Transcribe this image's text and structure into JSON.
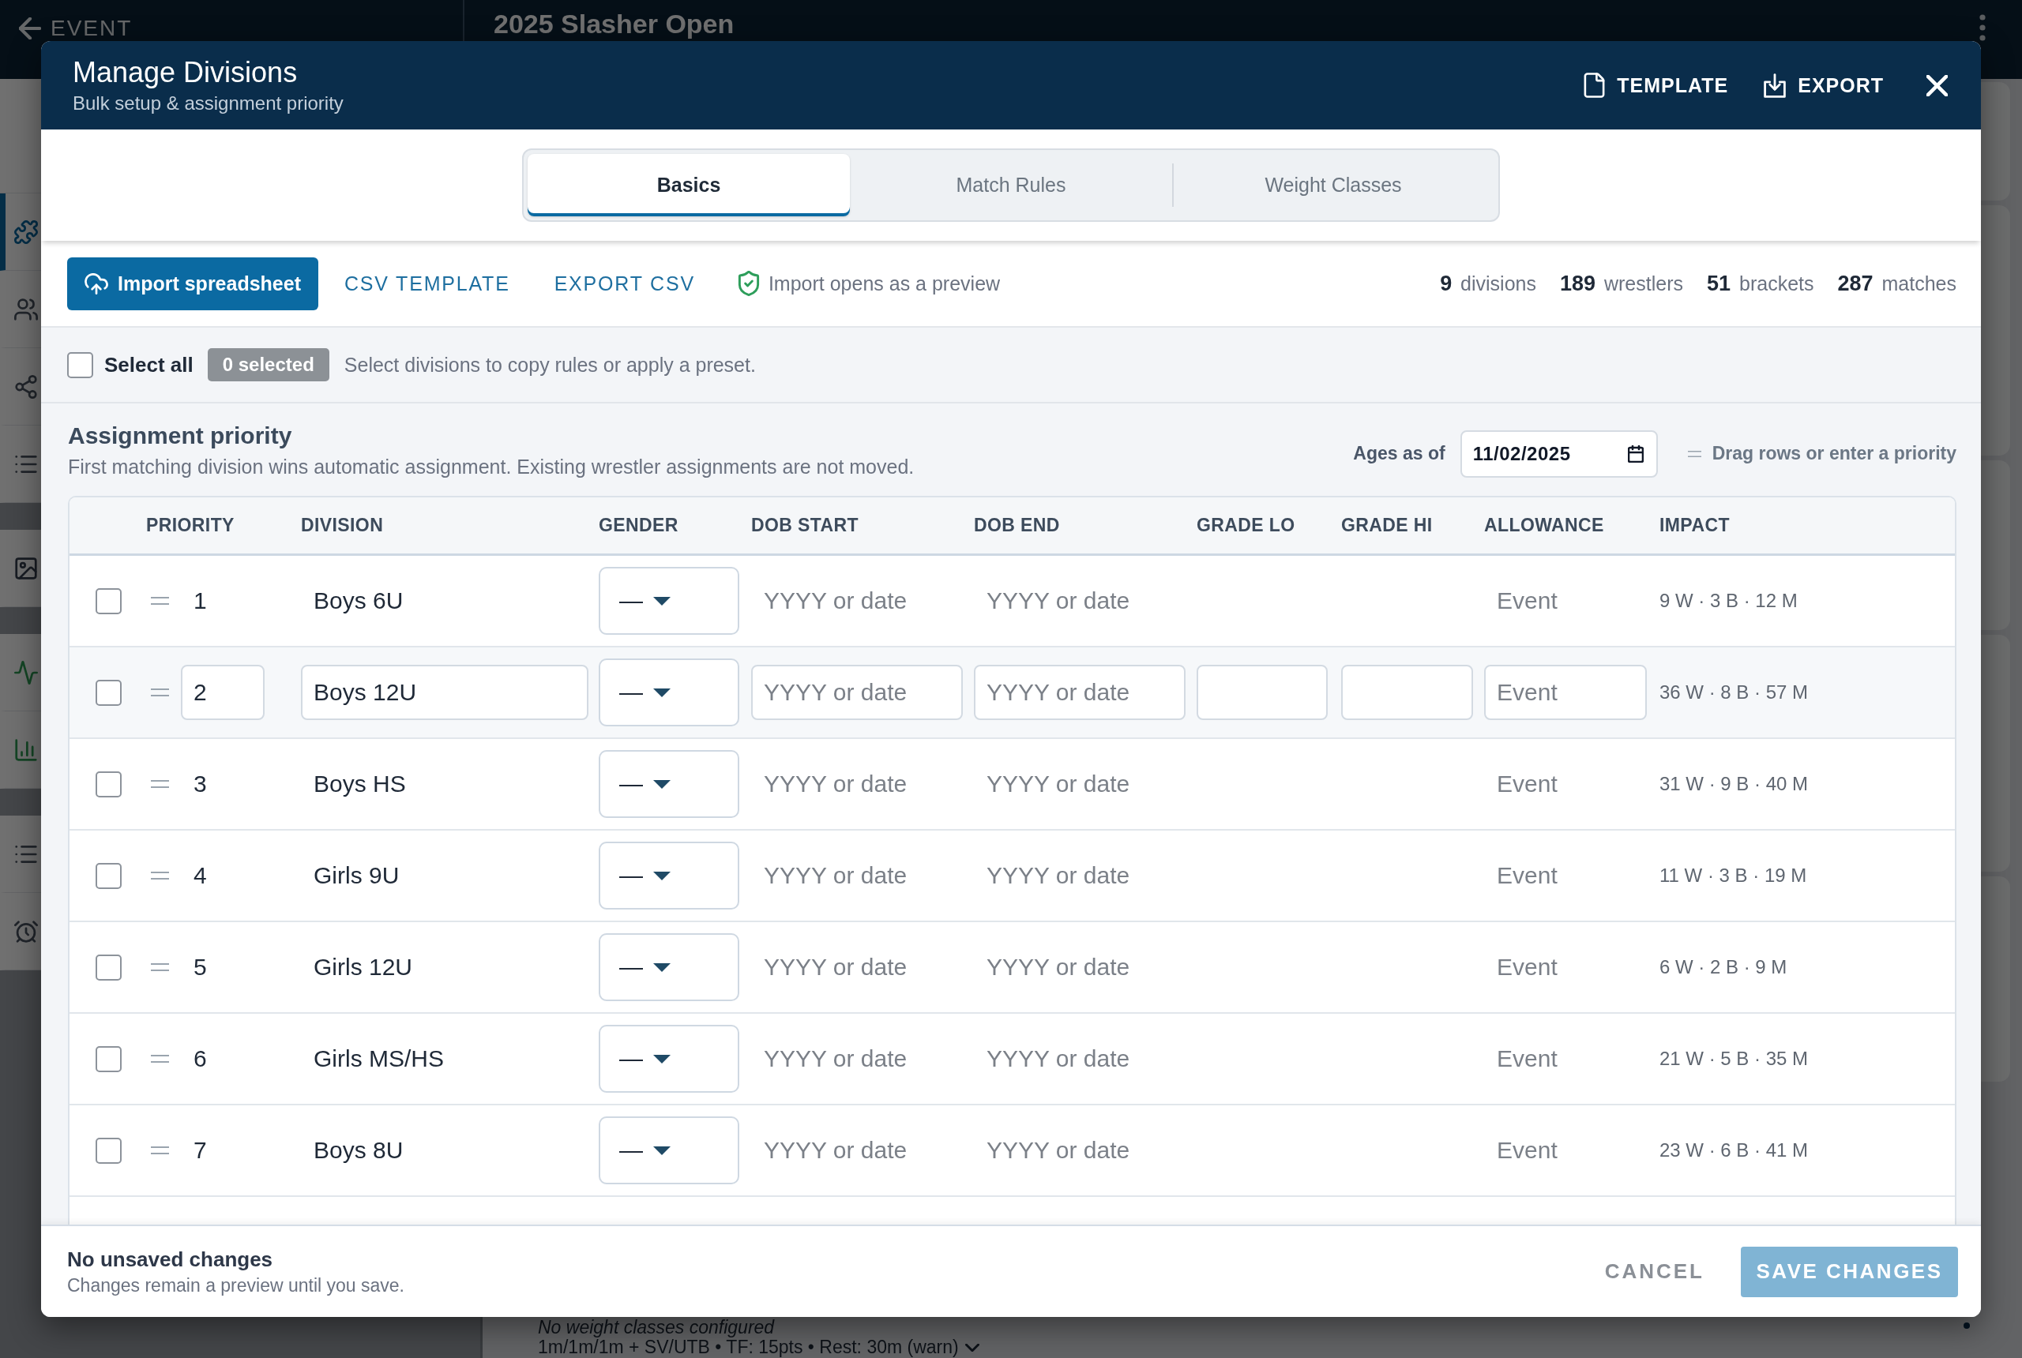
{
  "background": {
    "back_link": "EVENT",
    "event_title": "2025 Slasher Open",
    "sidebar_sections": [
      {
        "items": [
          {
            "kind": "puzzle",
            "selected": true
          },
          {
            "kind": "users",
            "selected": false
          },
          {
            "kind": "share",
            "selected": false
          },
          {
            "kind": "list",
            "selected": false
          }
        ]
      },
      {
        "items": [
          {
            "kind": "image",
            "selected": false
          }
        ]
      },
      {
        "items": [
          {
            "kind": "activity",
            "selected": false
          },
          {
            "kind": "chart",
            "selected": false
          }
        ]
      },
      {
        "items": [
          {
            "kind": "list",
            "selected": false
          },
          {
            "kind": "alarm",
            "selected": false
          }
        ]
      }
    ],
    "weight_classes_note": "No weight classes configured",
    "match_rules_summary": "1m/1m/1m + SV/UTB • TF: 15pts • Rest: 30m (warn)"
  },
  "dialog": {
    "title": "Manage Divisions",
    "subtitle": "Bulk setup & assignment priority",
    "actions": [
      {
        "kind": "template",
        "label": "TEMPLATE"
      },
      {
        "kind": "export",
        "label": "EXPORT"
      }
    ]
  },
  "tabs": [
    {
      "label": "Basics",
      "selected": true
    },
    {
      "label": "Match Rules",
      "selected": false
    },
    {
      "label": "Weight Classes",
      "selected": false
    }
  ],
  "toolbar": {
    "import_button": "Import spreadsheet",
    "links": [
      "CSV TEMPLATE",
      "EXPORT CSV"
    ],
    "note": "Import opens as a preview",
    "stats": [
      "**9** divisions",
      "**189** wrestlers",
      "**51** brackets",
      "**287** matches"
    ]
  },
  "selection": {
    "checked": false,
    "label": "Select all",
    "count_badge": "0 selected",
    "hint": "Select divisions to copy rules or apply a preset."
  },
  "assignment_priority": {
    "title": "Assignment priority",
    "description": "First matching division wins automatic assignment. Existing wrestler assignments are not moved.",
    "ages_as_of_label": "Ages as of",
    "ages_as_of_date": "11/02/2025",
    "drag_hint": "Drag rows or enter a priority"
  },
  "table": {
    "columns": [
      "PRIORITY",
      "DIVISION",
      "GENDER",
      "DOB START",
      "DOB END",
      "GRADE LO",
      "GRADE HI",
      "ALLOWANCE",
      "IMPACT"
    ],
    "rows": [
      {
        "checked": false,
        "editing": false,
        "priority": "1",
        "division": "Boys 6U",
        "gender": "—",
        "dob_start": {
          "placeholder": "YYYY or date"
        },
        "dob_end": {
          "placeholder": "YYYY or date"
        },
        "allowance": {
          "placeholder": "Event"
        },
        "impact": "9 W · 3 B · 12 M"
      },
      {
        "checked": false,
        "editing": true,
        "priority": "2",
        "division": "Boys 12U",
        "gender": "—",
        "dob_start": {
          "placeholder": "YYYY or date"
        },
        "dob_end": {
          "placeholder": "YYYY or date"
        },
        "allowance": {
          "placeholder": "Event"
        },
        "impact": "36 W · 8 B · 57 M"
      },
      {
        "checked": false,
        "editing": false,
        "priority": "3",
        "division": "Boys HS",
        "gender": "—",
        "dob_start": {
          "placeholder": "YYYY or date"
        },
        "dob_end": {
          "placeholder": "YYYY or date"
        },
        "allowance": {
          "placeholder": "Event"
        },
        "impact": "31 W · 9 B · 40 M"
      },
      {
        "checked": false,
        "editing": false,
        "priority": "4",
        "division": "Girls 9U",
        "gender": "—",
        "dob_start": {
          "placeholder": "YYYY or date"
        },
        "dob_end": {
          "placeholder": "YYYY or date"
        },
        "allowance": {
          "placeholder": "Event"
        },
        "impact": "11 W · 3 B · 19 M"
      },
      {
        "checked": false,
        "editing": false,
        "priority": "5",
        "division": "Girls 12U",
        "gender": "—",
        "dob_start": {
          "placeholder": "YYYY or date"
        },
        "dob_end": {
          "placeholder": "YYYY or date"
        },
        "allowance": {
          "placeholder": "Event"
        },
        "impact": "6 W · 2 B · 9 M"
      },
      {
        "checked": false,
        "editing": false,
        "priority": "6",
        "division": "Girls MS/HS",
        "gender": "—",
        "dob_start": {
          "placeholder": "YYYY or date"
        },
        "dob_end": {
          "placeholder": "YYYY or date"
        },
        "allowance": {
          "placeholder": "Event"
        },
        "impact": "21 W · 5 B · 35 M"
      },
      {
        "checked": false,
        "editing": false,
        "priority": "7",
        "division": "Boys 8U",
        "gender": "—",
        "dob_start": {
          "placeholder": "YYYY or date"
        },
        "dob_end": {
          "placeholder": "YYYY or date"
        },
        "allowance": {
          "placeholder": "Event"
        },
        "impact": "23 W · 6 B · 41 M"
      }
    ]
  },
  "footer": {
    "status": "No unsaved changes",
    "note": "Changes remain a preview until you save.",
    "cancel_label": "CANCEL",
    "save": {
      "label": "SAVE CHANGES",
      "disabled": true
    }
  }
}
